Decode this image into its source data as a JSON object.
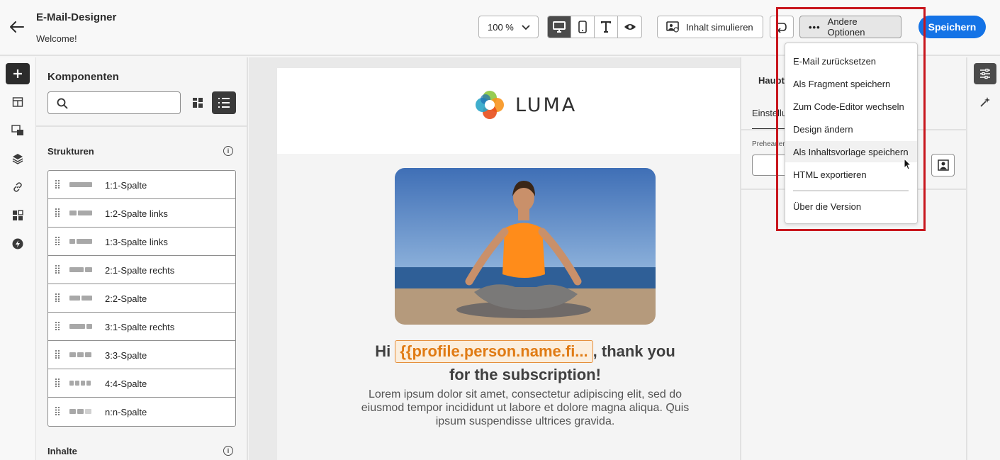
{
  "app": {
    "title": "E-Mail-Designer",
    "subtitle": "Welcome!"
  },
  "toolbar": {
    "zoom": "100 %",
    "simulate_label": "Inhalt simulieren",
    "more_options_label": "Andere Optionen",
    "save_label": "Speichern",
    "view_modes": [
      "desktop-icon",
      "mobile-icon",
      "text-icon",
      "preview-eye-icon"
    ],
    "active_view": "desktop"
  },
  "left_rail": {
    "items": [
      "add-icon",
      "structure-icon",
      "fragment-icon",
      "layers-icon",
      "link-icon",
      "assets-icon",
      "lightning-icon"
    ],
    "active": "add-icon"
  },
  "components": {
    "title": "Komponenten",
    "search_placeholder": "",
    "structures_title": "Strukturen",
    "contents_title": "Inhalte",
    "structures": [
      {
        "label": "1:1-Spalte"
      },
      {
        "label": "1:2-Spalte links"
      },
      {
        "label": "1:3-Spalte links"
      },
      {
        "label": "2:1-Spalte rechts"
      },
      {
        "label": "2:2-Spalte"
      },
      {
        "label": "3:1-Spalte rechts"
      },
      {
        "label": "3:3-Spalte"
      },
      {
        "label": "4:4-Spalte"
      },
      {
        "label": "n:n-Spalte"
      }
    ]
  },
  "email": {
    "logo_text": "LUMA",
    "greeting_prefix": "Hi",
    "token": "{{profile.person.name.fi...",
    "greeting_suffix": ", thank you",
    "greeting_line2": "for the subscription!",
    "body_text": "Lorem ipsum dolor sit amet, consectetur adipiscing elit, sed do eiusmod tempor incididunt ut labore et dolore magna aliqua. Quis ipsum suspendisse ultrices gravida."
  },
  "properties": {
    "title": "Hauptt",
    "tab": "Einstellu",
    "field_label": "Preheader"
  },
  "menu": {
    "items": [
      "E-Mail zurücksetzen",
      "Als Fragment speichern",
      "Zum Code-Editor wechseln",
      "Design ändern",
      "Als Inhaltsvorlage speichern",
      "HTML exportieren",
      "Über die Version"
    ],
    "hovered": "Als Inhaltsvorlage speichern"
  },
  "colors": {
    "accent": "#1473e6",
    "highlight": "#c8161d",
    "token_orange": "#e07b14"
  }
}
